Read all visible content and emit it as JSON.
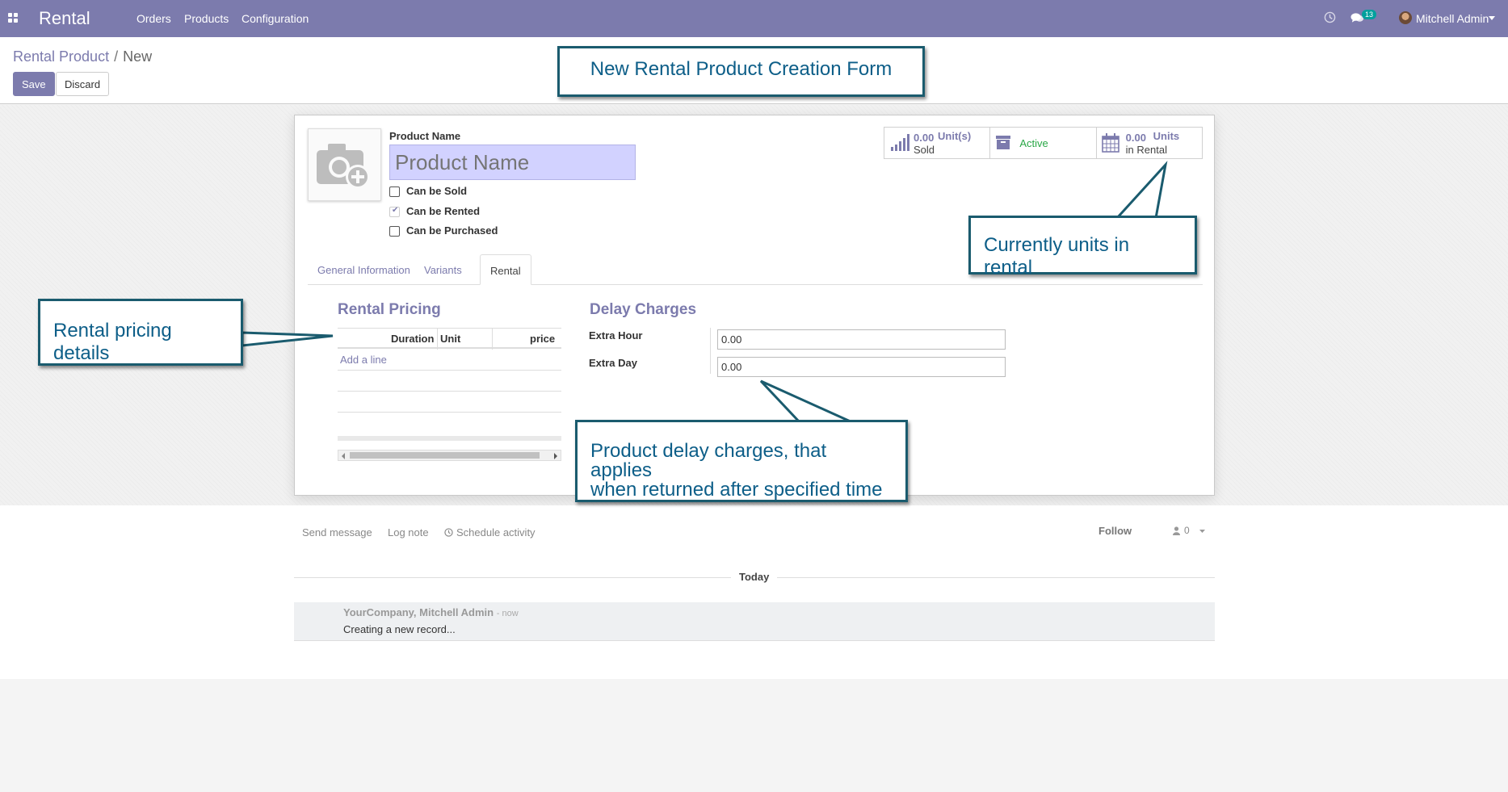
{
  "navbar": {
    "app_name": "Rental",
    "menus": [
      "Orders",
      "Products",
      "Configuration"
    ],
    "message_count": "13",
    "user_name": "Mitchell Admin"
  },
  "breadcrumb": {
    "parent": "Rental Product",
    "current": "New"
  },
  "actions": {
    "save": "Save",
    "discard": "Discard"
  },
  "form": {
    "product_name_label": "Product Name",
    "product_name_placeholder": "Product Name",
    "checkboxes": [
      {
        "label": "Can be Sold",
        "checked": false
      },
      {
        "label": "Can be Rented",
        "checked": true
      },
      {
        "label": "Can be Purchased",
        "checked": false
      }
    ],
    "stats": {
      "sold_value": "0.00",
      "sold_unit": "Unit(s)",
      "sold_label": "Sold",
      "active_label": "Active",
      "rental_value": "0.00",
      "rental_unit": "Units",
      "rental_label": "in Rental"
    },
    "tabs": [
      {
        "label": "General Information",
        "active": false
      },
      {
        "label": "Variants",
        "active": false
      },
      {
        "label": "Rental",
        "active": true
      }
    ],
    "rental_pricing": {
      "title": "Rental Pricing",
      "columns": [
        "Duration",
        "Unit",
        "price"
      ],
      "add_line": "Add a line"
    },
    "delay_charges": {
      "title": "Delay Charges",
      "extra_hour_label": "Extra Hour",
      "extra_hour_value": "0.00",
      "extra_day_label": "Extra Day",
      "extra_day_value": "0.00"
    }
  },
  "chatter": {
    "send_message": "Send message",
    "log_note": "Log note",
    "schedule_activity": "Schedule activity",
    "follow": "Follow",
    "followers_count": "0",
    "date_separator": "Today",
    "message_author": "YourCompany, Mitchell Admin",
    "message_time": "- now",
    "message_body": "Creating a new record..."
  },
  "annotations": {
    "title": "New Rental Product Creation Form",
    "units_in_rental": "Currently units in rental",
    "pricing_details": "Rental pricing details",
    "delay_line1": "Product delay charges, that applies",
    "delay_line2": "when returned after specified time"
  },
  "colors": {
    "brand": "#7c7bad",
    "annotation_border": "#1a5b6e",
    "annotation_text": "#0d5e88",
    "active": "#28a745"
  }
}
